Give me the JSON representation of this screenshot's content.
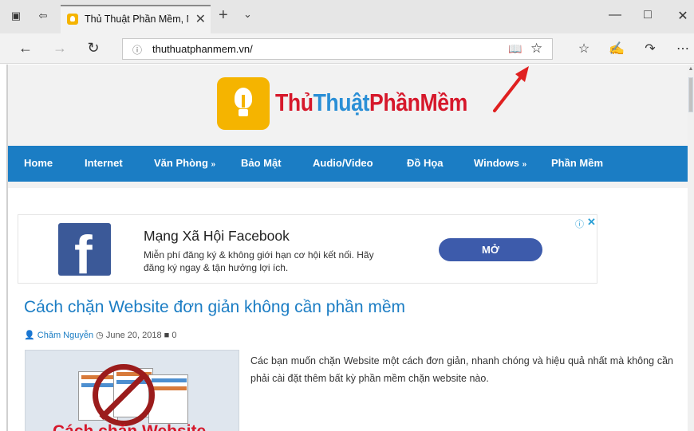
{
  "browser": {
    "tab_title": "Thủ Thuật Phần Mềm, N",
    "url": "thuthuatphanmem.vn/",
    "icons": [
      "tab-actions-icon",
      "set-aside-icon",
      "favicon",
      "tab-close-icon",
      "new-tab-icon",
      "tab-list-icon",
      "minimize-icon",
      "maximize-icon",
      "close-icon",
      "back-icon",
      "forward-icon",
      "refresh-icon",
      "site-info-icon",
      "reading-view-icon",
      "favorite-star-icon",
      "favorites-hub-icon",
      "pen-icon",
      "share-icon",
      "more-icon"
    ]
  },
  "site": {
    "logo": {
      "part1": "Thủ",
      "part2": "Thuật",
      "part3": "PhầnMềm"
    },
    "menu": [
      {
        "label": "Home",
        "dropdown": ""
      },
      {
        "label": "Internet",
        "dropdown": ""
      },
      {
        "label": "Văn Phòng",
        "dropdown": "»"
      },
      {
        "label": "Bảo Mật",
        "dropdown": ""
      },
      {
        "label": "Audio/Video",
        "dropdown": ""
      },
      {
        "label": "Đồ Họa",
        "dropdown": ""
      },
      {
        "label": "Windows",
        "dropdown": "»"
      },
      {
        "label": "Phần Mềm",
        "dropdown": ""
      }
    ],
    "menu_color": "#1b7dc4"
  },
  "ad": {
    "title": "Mạng Xã Hội Facebook",
    "desc_line1": "Miễn phí đăng ký & không giới hạn cơ hội kết nối. Hãy",
    "desc_line2": "đăng ký ngay & tận hưởng lợi ích.",
    "button": "MỞ",
    "logo_letter": "f"
  },
  "post": {
    "title": "Cách chặn Website đơn giản không cần phần mềm",
    "author": "Chăm Nguyễn",
    "date": "June 20, 2018",
    "comments": "0",
    "thumb_caption": "Cách chặn Website",
    "excerpt": "Các bạn muốn chặn Website một cách đơn giản, nhanh chóng và hiệu quả nhất mà không cần phải cài đặt thêm bất kỳ phần mềm chặn website nào."
  }
}
